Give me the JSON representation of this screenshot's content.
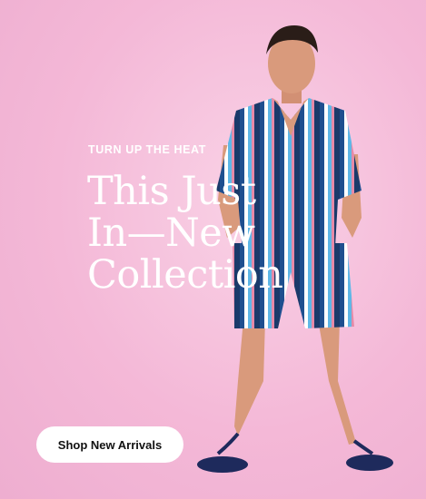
{
  "hero": {
    "eyebrow": "TURN UP THE HEAT",
    "headline_lines": [
      "This Just",
      "In—New",
      "Collection"
    ],
    "cta_label": "Shop New Arrivals"
  },
  "colors": {
    "background": "#f4b8d7",
    "headline_text": "#ffffff",
    "cta_background": "#ffffff",
    "cta_text": "#111111"
  }
}
